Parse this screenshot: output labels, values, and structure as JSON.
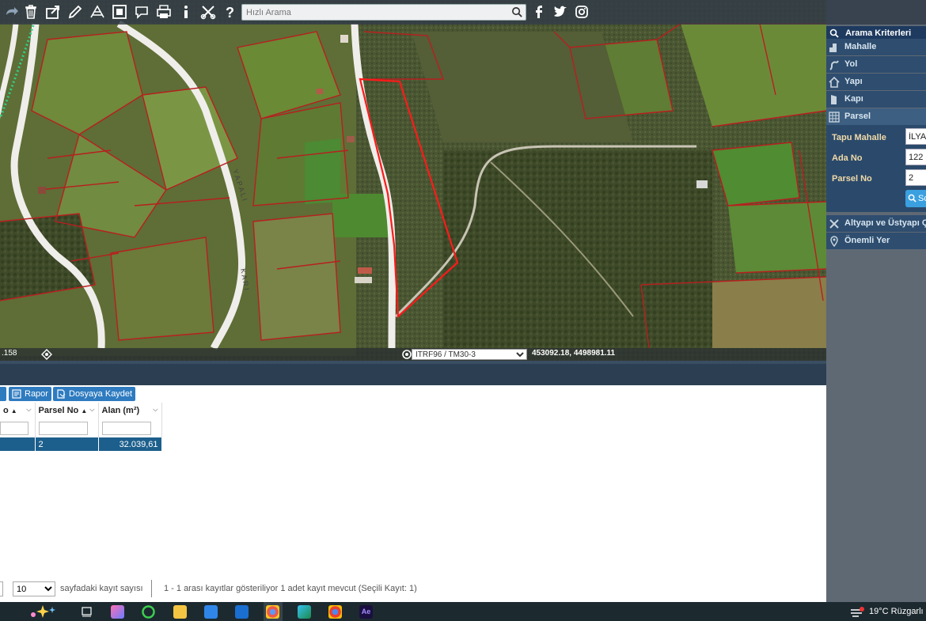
{
  "toolbar": {
    "search_placeholder": "Hızlı Arama",
    "icons": [
      "redo-icon",
      "trash-icon",
      "share-icon",
      "pencil-icon",
      "measure-icon",
      "fullscreen-icon",
      "comment-icon",
      "print-icon",
      "info-icon",
      "tools-icon",
      "help-icon",
      "search-icon",
      "facebook-icon",
      "twitter-icon",
      "instagram-icon"
    ]
  },
  "right_panel": {
    "header": "Arama Kriterleri",
    "menu": {
      "mahalle": "Mahalle",
      "yol": "Yol",
      "yapi": "Yapı",
      "kapi": "Kapı",
      "parsel": "Parsel",
      "altyapi": "Altyapı ve Üstyapı Ça",
      "onemli_yer": "Önemli Yer"
    },
    "form": {
      "tapu_mahalle_label": "Tapu Mahalle",
      "tapu_mahalle_value": "İLYA",
      "ada_no_label": "Ada No",
      "ada_no_value": "122",
      "parsel_no_label": "Parsel No",
      "parsel_no_value": "2",
      "search_button": "Sc"
    }
  },
  "map": {
    "scale_text": ".158",
    "projection": "ITRF96 / TM30-3",
    "coordinates": "453092.18, 4498981.11",
    "road_labels": [
      "Y A P A L I",
      "K A R I"
    ]
  },
  "bottom": {
    "buttons": {
      "rapor": "Rapor",
      "kaydet": "Dosyaya Kaydet"
    },
    "columns": {
      "col0": "o",
      "parsel_no": "Parsel No",
      "alan": "Alan (m²)"
    },
    "rows": [
      {
        "parsel_no": "2",
        "alan": "32.039,61"
      }
    ],
    "page_size": "10",
    "page_size_label": "sayfadaki kayıt sayısı",
    "record_info": "1 - 1 arası kayıtlar gösteriliyor 1 adet kayıt mevcut (Seçili Kayıt: 1)"
  },
  "taskbar": {
    "weather": "19°C  Rüzgarlı"
  },
  "colors": {
    "panel_header": "#1e3a5f",
    "panel_item": "#2e4d6f",
    "accent_label": "#f0d9a8",
    "parcel_highlight": "#ff1a1a",
    "selected_row": "#1d5f8c",
    "button_blue": "#2e7bc0"
  }
}
